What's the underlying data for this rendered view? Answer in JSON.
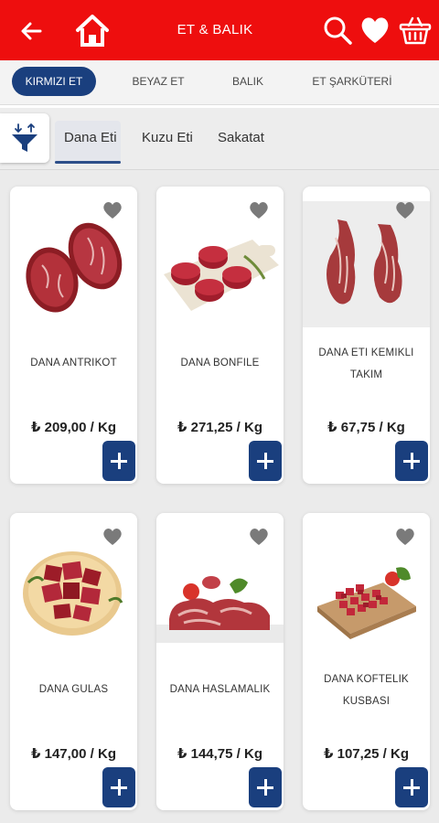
{
  "header": {
    "title": "ET & BALIK",
    "color": "#ee0e0e"
  },
  "categories": [
    {
      "label": "KIRMIZI ET",
      "active": true
    },
    {
      "label": "BEYAZ ET",
      "active": false
    },
    {
      "label": "BALIK",
      "active": false
    },
    {
      "label": "ET ŞARKÜTERİ",
      "active": false
    }
  ],
  "subcategories": [
    {
      "label": "Dana Eti",
      "active": true
    },
    {
      "label": "Kuzu Eti",
      "active": false
    },
    {
      "label": "Sakatat",
      "active": false
    }
  ],
  "products": [
    {
      "name": "DANA ANTRIKOT",
      "price": "₺ 209,00 / Kg",
      "image": "ribeye-steaks"
    },
    {
      "name": "DANA BONFILE",
      "price": "₺ 271,25 / Kg",
      "image": "tenderloin-on-board"
    },
    {
      "name": "DANA ETI KEMIKLI TAKIM",
      "name_lines": [
        "DANA ETI KEMIKLI",
        "TAKIM"
      ],
      "price": "₺ 67,75 / Kg",
      "image": "bone-in-carcass"
    },
    {
      "name": "DANA GULAS",
      "price": "₺ 147,00 / Kg",
      "image": "goulash-cubes-plate"
    },
    {
      "name": "DANA HASLAMALIK",
      "price": "₺ 144,75 / Kg",
      "image": "boiling-meat-chunks"
    },
    {
      "name": "DANA KOFTELIK KUSBASI",
      "name_lines": [
        "DANA KOFTELIK",
        "KUSBASI"
      ],
      "price": "₺ 107,25 / Kg",
      "image": "cubed-meat-board"
    }
  ],
  "colors": {
    "primary": "#1a3f7e",
    "accent": "#ee0e0e"
  }
}
